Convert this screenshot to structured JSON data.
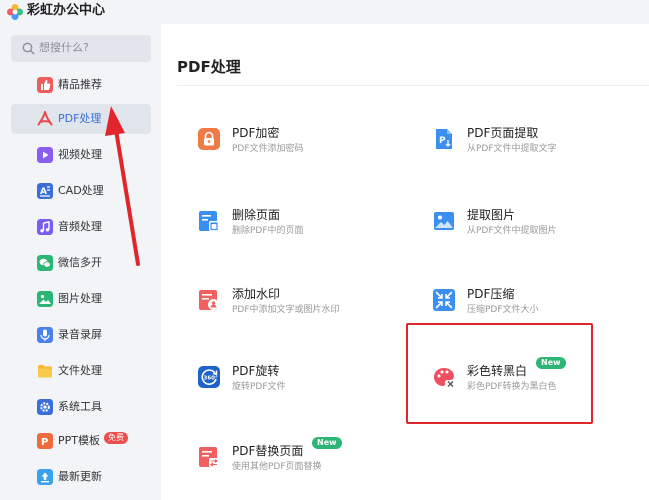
{
  "app": {
    "title": "彩虹办公中心"
  },
  "search": {
    "placeholder": "想搜什么?"
  },
  "sidebar": {
    "items": [
      {
        "label": "精品推荐",
        "icon": "thumbs-up-icon",
        "color": "#ee5d5d"
      },
      {
        "label": "PDF处理",
        "icon": "pdf-icon",
        "color": "#e84a4a",
        "active": true
      },
      {
        "label": "视频处理",
        "icon": "play-icon",
        "color": "#8b5cf0"
      },
      {
        "label": "CAD处理",
        "icon": "cad-icon",
        "color": "#3a6fdb"
      },
      {
        "label": "音频处理",
        "icon": "music-icon",
        "color": "#7a5cf0"
      },
      {
        "label": "微信多开",
        "icon": "wechat-icon",
        "color": "#2bb673"
      },
      {
        "label": "图片处理",
        "icon": "image-icon",
        "color": "#2bb673"
      },
      {
        "label": "录音录屏",
        "icon": "microphone-icon",
        "color": "#4a7ff0"
      },
      {
        "label": "文件处理",
        "icon": "folder-icon",
        "color": "#f5b82e"
      },
      {
        "label": "系统工具",
        "icon": "gear-icon",
        "color": "#3a6fdb"
      },
      {
        "label": "PPT模板",
        "icon": "ppt-icon",
        "color": "#f06a3c",
        "badge": "免费"
      },
      {
        "label": "最新更新",
        "icon": "upload-icon",
        "color": "#3aa0f0"
      }
    ]
  },
  "main": {
    "title": "PDF处理",
    "tools": [
      {
        "name": "PDF加密",
        "desc": "PDF文件添加密码",
        "icon": "lock-icon",
        "color": "#f07a45"
      },
      {
        "name": "PDF页面提取",
        "desc": "从PDF文件中提取文字",
        "icon": "extract-page-icon",
        "color": "#3a8ff0"
      },
      {
        "name": "删除页面",
        "desc": "删除PDF中的页面",
        "icon": "delete-page-icon",
        "color": "#3a8ff0"
      },
      {
        "name": "提取图片",
        "desc": "从PDF文件中提取图片",
        "icon": "extract-image-icon",
        "color": "#3a8ff0"
      },
      {
        "name": "添加水印",
        "desc": "PDF中添加文字或图片水印",
        "icon": "watermark-icon",
        "color": "#f06060"
      },
      {
        "name": "PDF压缩",
        "desc": "压缩PDF文件大小",
        "icon": "compress-icon",
        "color": "#3a8ff0"
      },
      {
        "name": "PDF旋转",
        "desc": "旋转PDF文件",
        "icon": "rotate-icon",
        "color": "#1e63c9"
      },
      {
        "name": "彩色转黑白",
        "desc": "彩色PDF转换为黑白色",
        "icon": "color-to-bw-icon",
        "color": "#ee5060",
        "badge": "New"
      },
      {
        "name": "PDF替换页面",
        "desc": "使用其他PDF页面替换",
        "icon": "replace-page-icon",
        "color": "#f06060",
        "badge": "New"
      }
    ]
  },
  "colors": {
    "accent": "#3a6fdb",
    "annotation": "#e0262c",
    "new_badge": "#2bb673",
    "free_badge": "#ee4d4d"
  }
}
